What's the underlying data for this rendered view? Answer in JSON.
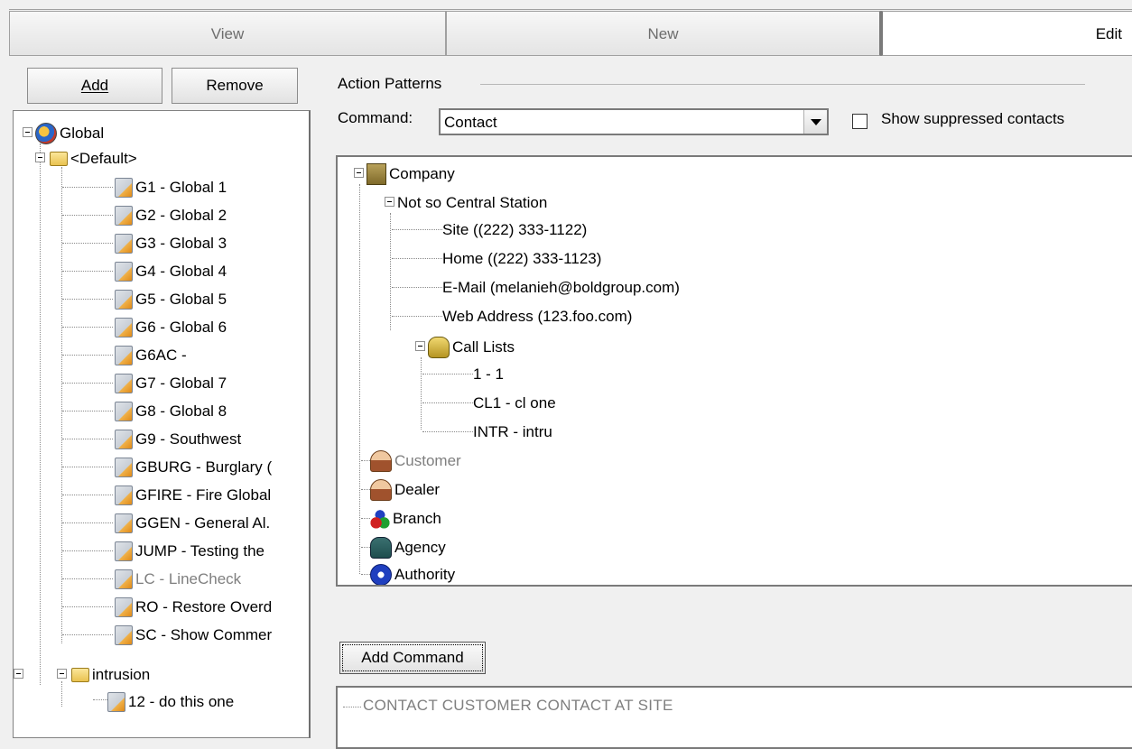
{
  "tabs": [
    {
      "label": "View",
      "active": false
    },
    {
      "label": "New",
      "active": false
    },
    {
      "label": "Edit",
      "active": true
    }
  ],
  "left_panel": {
    "add_label": "Add",
    "remove_label": "Remove",
    "tree": {
      "root": "Global",
      "groups": [
        {
          "label": "<Default>",
          "items": [
            "G1 - Global 1",
            "G2 - Global 2",
            "G3 - Global 3",
            "G4 - Global 4",
            "G5 - Global 5",
            "G6 - Global 6",
            "G6AC -",
            "G7 - Global 7",
            "G8 - Global 8",
            "G9 - Southwest",
            "GBURG - Burglary (",
            "GFIRE - Fire Global",
            "GGEN - General Al.",
            "JUMP - Testing the",
            "LC - LineCheck",
            "RO - Restore Overd",
            "SC - Show Commer"
          ],
          "greyed_item": "LC - LineCheck"
        },
        {
          "label": "intrusion",
          "items": [
            "12 - do this one"
          ]
        }
      ]
    }
  },
  "action_patterns": {
    "group_label": "Action Patterns",
    "command_label": "Command:",
    "command_value": "Contact",
    "show_suppressed_label": "Show suppressed contacts",
    "show_suppressed_checked": false,
    "tree": {
      "company": "Company",
      "station": "Not so Central Station",
      "contacts": [
        "Site ((222) 333-1122)",
        "Home ((222) 333-1123)",
        "E-Mail (melanieh@boldgroup.com)",
        "Web Address (123.foo.com)"
      ],
      "call_lists": "Call Lists",
      "call_list_items": [
        "1 - 1",
        "CL1 - cl one",
        "INTR - intru"
      ],
      "others": [
        "Customer",
        "Dealer",
        "Branch",
        "Agency",
        "Authority"
      ]
    },
    "add_command_label": "Add Command",
    "command_text": "CONTACT CUSTOMER CONTACT AT SITE"
  }
}
